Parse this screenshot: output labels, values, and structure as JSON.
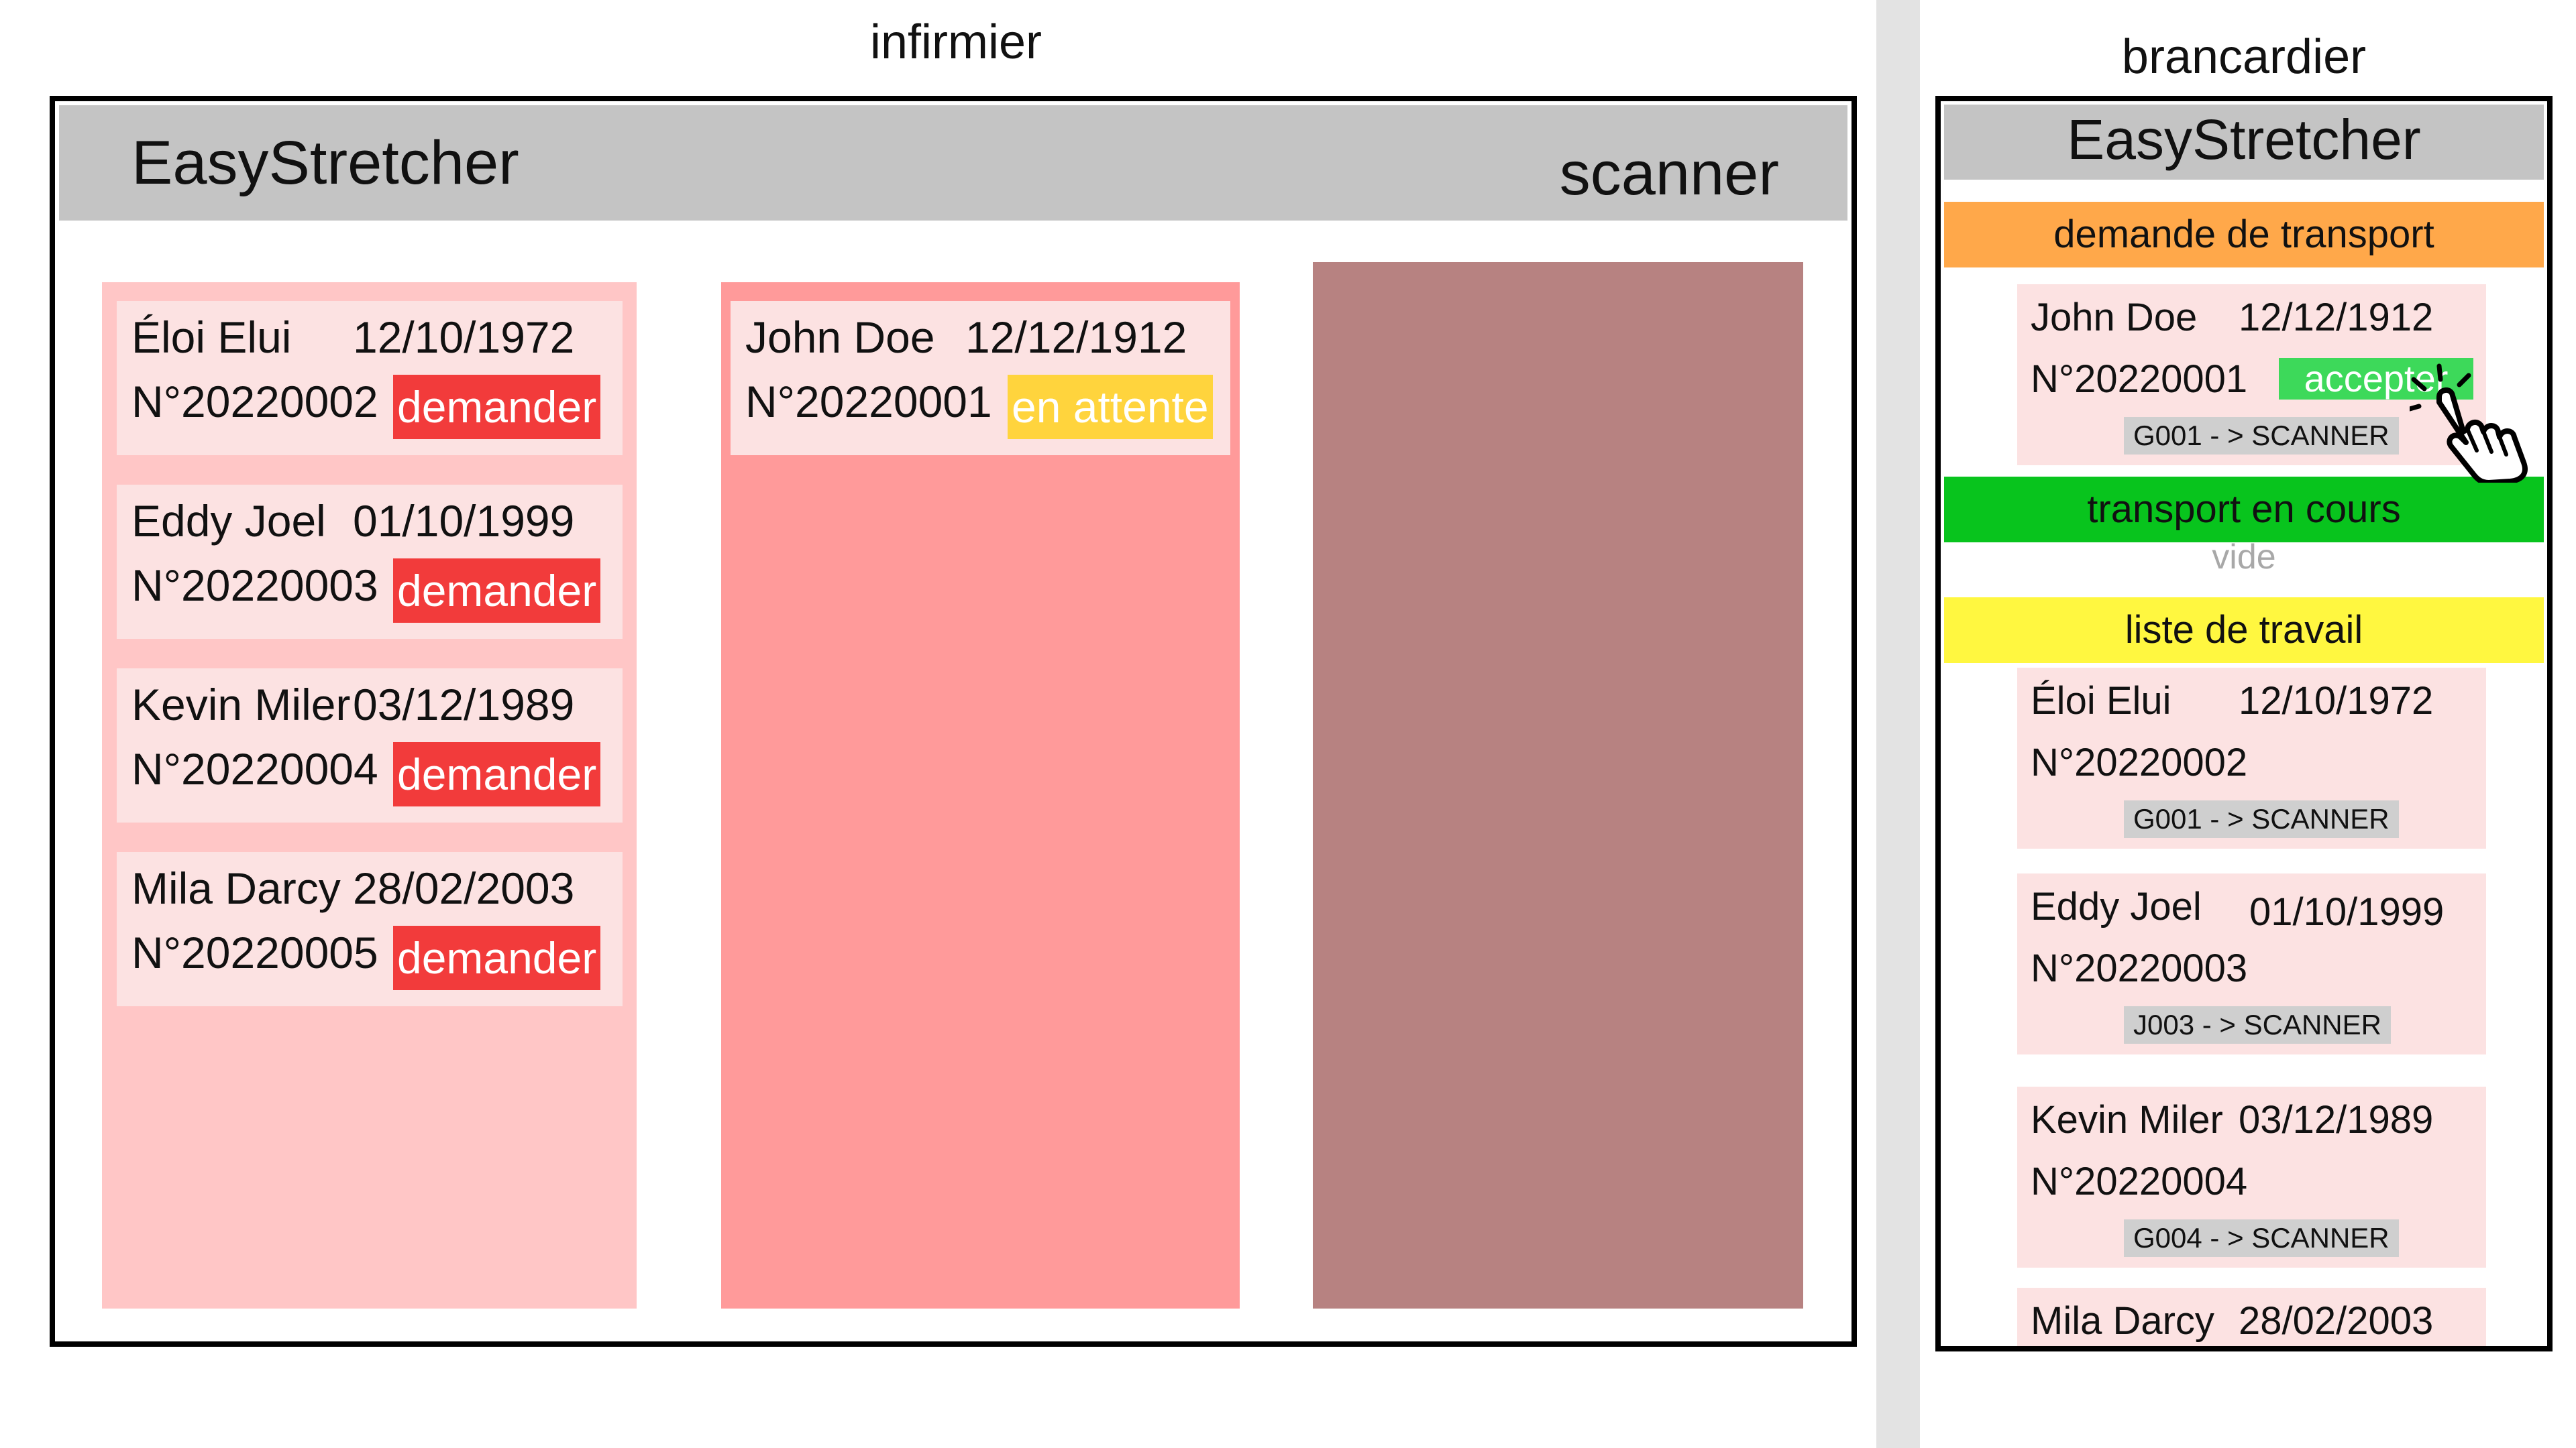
{
  "nurse": {
    "section_label": "infirmier",
    "app_title": "EasyStretcher",
    "service_name": "scanner",
    "pending_list": [
      {
        "name": "Éloi Elui",
        "dob": "12/10/1972",
        "number": "N°20220002",
        "action": "demander"
      },
      {
        "name": "Eddy Joel",
        "dob": "01/10/1999",
        "number": "N°20220003",
        "action": "demander"
      },
      {
        "name": "Kevin Miler",
        "dob": "03/12/1989",
        "number": "N°20220004",
        "action": "demander"
      },
      {
        "name": "Mila Darcy",
        "dob": "28/02/2003",
        "number": "N°20220005",
        "action": "demander"
      }
    ],
    "requested_list": [
      {
        "name": "John Doe",
        "dob": "12/12/1912",
        "number": "N°20220001",
        "status": "en attente"
      }
    ],
    "colors": {
      "column_1": "#ffc6c6",
      "column_2": "#ff9a9a",
      "column_3": "#b78281",
      "request_button": "#f23b3b",
      "waiting_badge": "#ffd43d"
    }
  },
  "porter": {
    "section_label": "brancardier",
    "app_title": "EasyStretcher",
    "transport_request": {
      "title": "demande de transport",
      "card": {
        "name": "John Doe",
        "dob": "12/12/1912",
        "number": "N°20220001",
        "action": "accepter",
        "route": "G001 - > SCANNER"
      }
    },
    "transport_in_progress": {
      "title": "transport en cours",
      "empty_text": "vide"
    },
    "work_list": {
      "title": "liste de travail",
      "items": [
        {
          "name": "Éloi Elui",
          "dob": "12/10/1972",
          "number": "N°20220002",
          "route": "G001 - > SCANNER"
        },
        {
          "name": "Eddy Joel",
          "dob": "01/10/1999",
          "number": "N°20220003",
          "route": "J003 - > SCANNER"
        },
        {
          "name": "Kevin Miler",
          "dob": "03/12/1989",
          "number": "N°20220004",
          "route": "G004 - > SCANNER"
        },
        {
          "name": "Mila Darcy",
          "dob": "28/02/2003"
        }
      ]
    },
    "colors": {
      "request_bar": "#ffa84a",
      "in_progress_bar": "#08c41d",
      "work_list_bar": "#fff740",
      "accept_button": "#3dd95a"
    }
  },
  "icons": {
    "pointer": "hand-pointer-icon"
  }
}
